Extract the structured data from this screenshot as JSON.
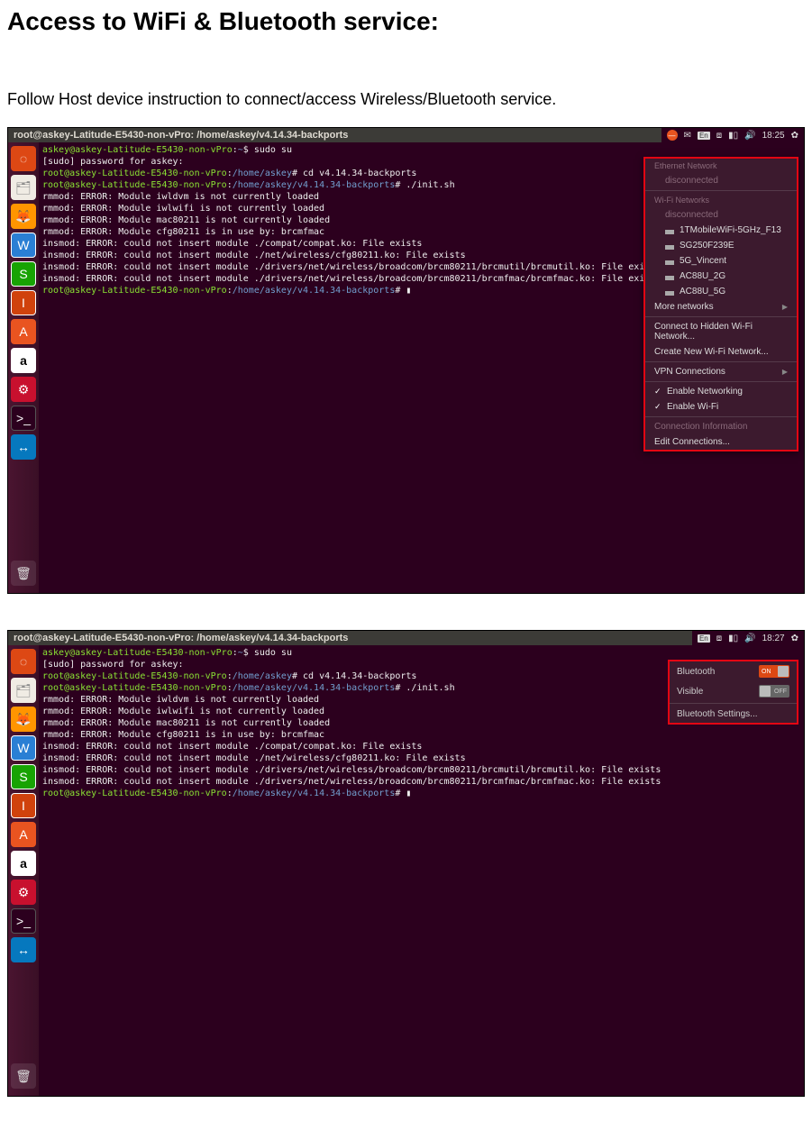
{
  "doc": {
    "heading": "Access to WiFi & Bluetooth service:",
    "instruction": "Follow Host device instruction to connect/access Wireless/Bluetooth service."
  },
  "launcher_icons": {
    "ubuntu": "◌",
    "files": "🗂",
    "firefox": "🦊",
    "docs": "W",
    "sheets": "S",
    "impress": "I",
    "software": "A",
    "amazon": "a",
    "settings": "⚙",
    "terminal": ">_",
    "teamviewer": "↔",
    "trash": "🗑"
  },
  "shot1": {
    "window_title": "root@askey-Latitude-E5430-non-vPro: /home/askey/v4.14.34-backports",
    "topbar": {
      "close": "—",
      "mail": "✉",
      "lang": "En",
      "bt": "⧈",
      "batt": "▮▯",
      "vol": "🔊",
      "time": "18:25",
      "gear": "✿"
    },
    "terminal": {
      "line1_user": "askey@askey-Latitude-E5430-non-vPro",
      "line1_path": "~",
      "line1_cmd": "sudo su",
      "line2": "[sudo] password for askey:",
      "line3_user": "root@askey-Latitude-E5430-non-vPro",
      "line3_path": "/home/askey",
      "line3_cmd": "cd v4.14.34-backports",
      "line4_path": "/home/askey/v4.14.34-backports",
      "line4_cmd": "./init.sh",
      "line5": "rmmod: ERROR: Module iwldvm is not currently loaded",
      "line6": "rmmod: ERROR: Module iwlwifi is not currently loaded",
      "line7": "rmmod: ERROR: Module mac80211 is not currently loaded",
      "line8": "rmmod: ERROR: Module cfg80211 is in use by: brcmfmac",
      "line9": "insmod: ERROR: could not insert module ./compat/compat.ko: File exists",
      "line10": "insmod: ERROR: could not insert module ./net/wireless/cfg80211.ko: File exists",
      "line11": "insmod: ERROR: could not insert module ./drivers/net/wireless/broadcom/brcm80211/brcmutil/brcmutil.ko: File exists",
      "line12": "insmod: ERROR: could not insert module ./drivers/net/wireless/broadcom/brcm80211/brcmfmac/brcmfmac.ko: File exists",
      "cursor": "▮"
    },
    "nm": {
      "ethernet_label": "Ethernet Network",
      "ethernet_state": "disconnected",
      "wifi_label": "Wi-Fi Networks",
      "wifi_state": "disconnected",
      "nets": [
        "1TMobileWiFi-5GHz_F13",
        "SG250F239E",
        "5G_Vincent",
        "AC88U_2G",
        "AC88U_5G"
      ],
      "more": "More networks",
      "hidden": "Connect to Hidden Wi-Fi Network...",
      "create": "Create New Wi-Fi Network...",
      "vpn": "VPN Connections",
      "enable_net": "Enable Networking",
      "enable_wifi": "Enable Wi-Fi",
      "conn_info": "Connection Information",
      "edit": "Edit Connections..."
    }
  },
  "shot2": {
    "window_title": "root@askey-Latitude-E5430-non-vPro: /home/askey/v4.14.34-backports",
    "topbar": {
      "lang": "En",
      "bt": "⧈",
      "batt": "▮▯",
      "vol": "🔊",
      "time": "18:27",
      "gear": "✿"
    },
    "terminal": {
      "line1_user": "askey@askey-Latitude-E5430-non-vPro",
      "line1_path": "~",
      "line1_cmd": "sudo su",
      "line2": "[sudo] password for askey:",
      "line3_user": "root@askey-Latitude-E5430-non-vPro",
      "line3_path": "/home/askey",
      "line3_cmd": "cd v4.14.34-backports",
      "line4_path": "/home/askey/v4.14.34-backports",
      "line4_cmd": "./init.sh",
      "line5": "rmmod: ERROR: Module iwldvm is not currently loaded",
      "line6": "rmmod: ERROR: Module iwlwifi is not currently loaded",
      "line7": "rmmod: ERROR: Module mac80211 is not currently loaded",
      "line8": "rmmod: ERROR: Module cfg80211 is in use by: brcmfmac",
      "line9": "insmod: ERROR: could not insert module ./compat/compat.ko: File exists",
      "line10": "insmod: ERROR: could not insert module ./net/wireless/cfg80211.ko: File exists",
      "line11": "insmod: ERROR: could not insert module ./drivers/net/wireless/broadcom/brcm80211/brcmutil/brcmutil.ko: File exists",
      "line12": "insmod: ERROR: could not insert module ./drivers/net/wireless/broadcom/brcm80211/brcmfmac/brcmfmac.ko: File exists",
      "cursor": "▮"
    },
    "bt": {
      "bluetooth_label": "Bluetooth",
      "bluetooth_state": "ON",
      "visible_label": "Visible",
      "visible_state": "OFF",
      "settings": "Bluetooth Settings..."
    }
  }
}
